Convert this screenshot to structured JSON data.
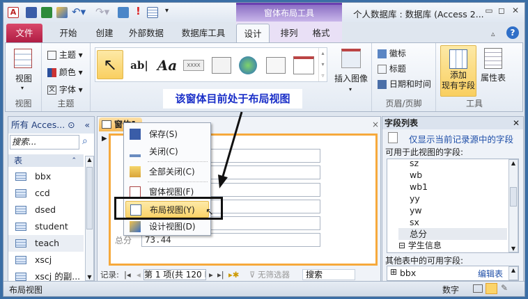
{
  "window": {
    "title": "个人数据库 : 数据库 (Access 2...",
    "context_tab_group": "窗体布局工具"
  },
  "tabs": [
    "文件",
    "开始",
    "创建",
    "外部数据",
    "数据库工具",
    "设计",
    "排列",
    "格式"
  ],
  "active_tab": "设计",
  "ribbon": {
    "view_group": {
      "button": "视图",
      "label": "视图"
    },
    "theme_group": {
      "items": [
        "主题",
        "颜色",
        "字体"
      ],
      "label": "主题"
    },
    "insert_image": "插入图像",
    "header_footer": {
      "items": [
        "徽标",
        "标题",
        "日期和时间"
      ],
      "label": "页眉/页脚"
    },
    "tools": {
      "add_fields": "添加\n现有字段",
      "add_fields_1": "添加",
      "add_fields_2": "现有字段",
      "property_sheet": "属性表",
      "label": "工具"
    },
    "gallery": {
      "textbox_icon": "ab|",
      "label_icon": "Aa",
      "button_icon": "XXXX"
    }
  },
  "annotation": "该窗体目前处于布局视图",
  "nav": {
    "header": "所有 Acces...",
    "search_placeholder": "搜索...",
    "section": "表",
    "items": [
      "bbx",
      "ccd",
      "dsed",
      "student",
      "teach",
      "xscj",
      "xscj 的副..."
    ],
    "selected": "teach"
  },
  "document": {
    "tab": "窗体1",
    "field_label": "总分",
    "field_value": "73.44",
    "record_nav": {
      "label": "记录:",
      "position": "第 1 项(共 120 I",
      "filter": "无筛选器",
      "search": "搜索"
    }
  },
  "context_menu": {
    "items": [
      "保存(S)",
      "关闭(C)",
      "全部关闭(C)",
      "窗体视图(F)",
      "布局视图(Y)",
      "设计视图(D)"
    ],
    "highlighted": "布局视图(Y)"
  },
  "field_list": {
    "title": "字段列表",
    "link": "仅显示当前记录源中的字段",
    "available_label": "可用于此视图的字段:",
    "fields": [
      "sz",
      "wb",
      "wb1",
      "yy",
      "yw",
      "sx",
      "总分"
    ],
    "selected": "总分",
    "partial": "学生信息",
    "other_label": "其他表中的可用字段:",
    "other_tables": [
      "bbx"
    ],
    "edit_table": "编辑表"
  },
  "status": {
    "left": "布局视图",
    "mode": "数字"
  }
}
